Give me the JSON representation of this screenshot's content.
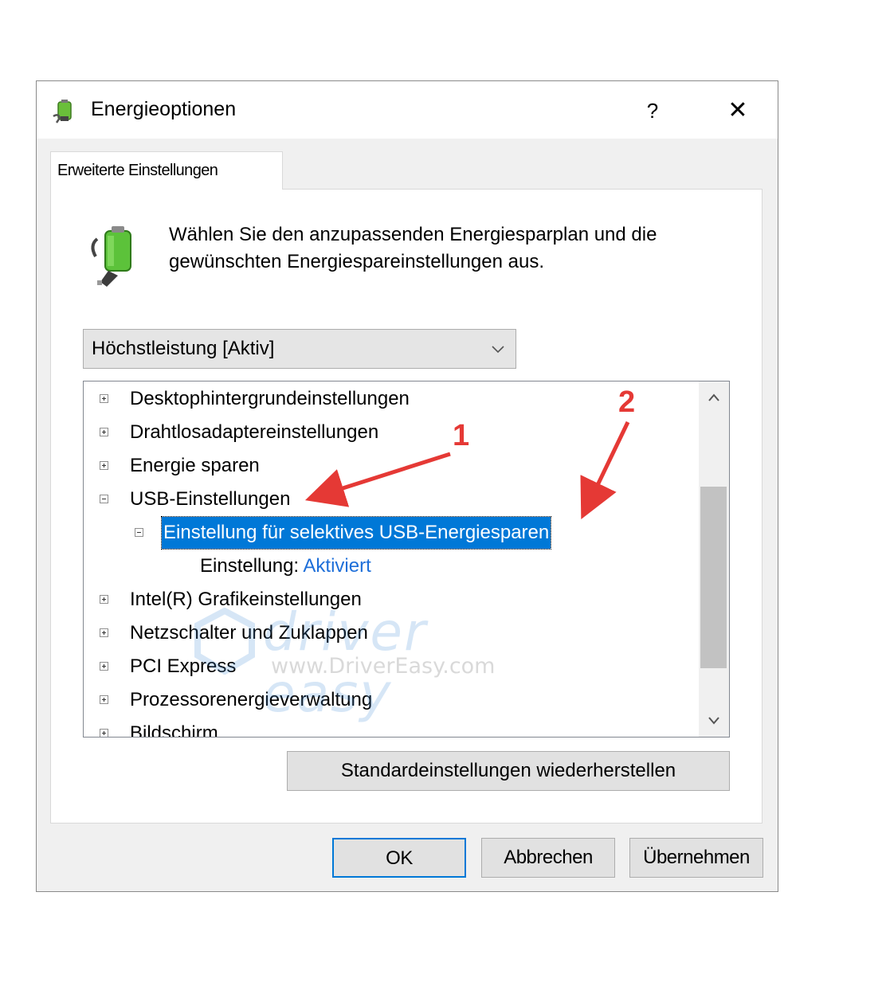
{
  "window": {
    "title": "Energieoptionen",
    "help_label": "?",
    "close_label": "✕"
  },
  "tab": {
    "label": "Erweiterte Einstellungen"
  },
  "description": "Wählen Sie den anzupassenden Energiesparplan und die gewünschten Energiespareinstellungen aus.",
  "plan_select": {
    "value": "Höchstleistung [Aktiv]"
  },
  "tree": {
    "items": [
      {
        "label": "Desktophintergrundeinstellungen",
        "state": "collapsed"
      },
      {
        "label": "Drahtlosadaptereinstellungen",
        "state": "collapsed"
      },
      {
        "label": "Energie sparen",
        "state": "collapsed"
      },
      {
        "label": "USB-Einstellungen",
        "state": "expanded"
      },
      {
        "label": "Einstellung für selektives USB-Energiesparen",
        "state": "expanded",
        "selected": true
      },
      {
        "label": "Einstellung:",
        "value": "Aktiviert"
      },
      {
        "label": "Intel(R) Grafikeinstellungen",
        "state": "collapsed"
      },
      {
        "label": "Netzschalter und Zuklappen",
        "state": "collapsed"
      },
      {
        "label": "PCI Express",
        "state": "collapsed"
      },
      {
        "label": "Prozessorenergieverwaltung",
        "state": "collapsed"
      },
      {
        "label": "Bildschirm",
        "state": "collapsed"
      }
    ]
  },
  "buttons": {
    "restore": "Standardeinstellungen wiederherstellen",
    "ok": "OK",
    "cancel": "Abbrechen",
    "apply": "Übernehmen"
  },
  "annotations": {
    "one": "1",
    "two": "2",
    "color": "#e53935"
  },
  "watermark": {
    "brand": "driver easy",
    "url": "www.DriverEasy.com"
  },
  "colors": {
    "selection": "#0078d7",
    "link": "#1e6fd9",
    "dialog_bg": "#f0f0f0"
  }
}
